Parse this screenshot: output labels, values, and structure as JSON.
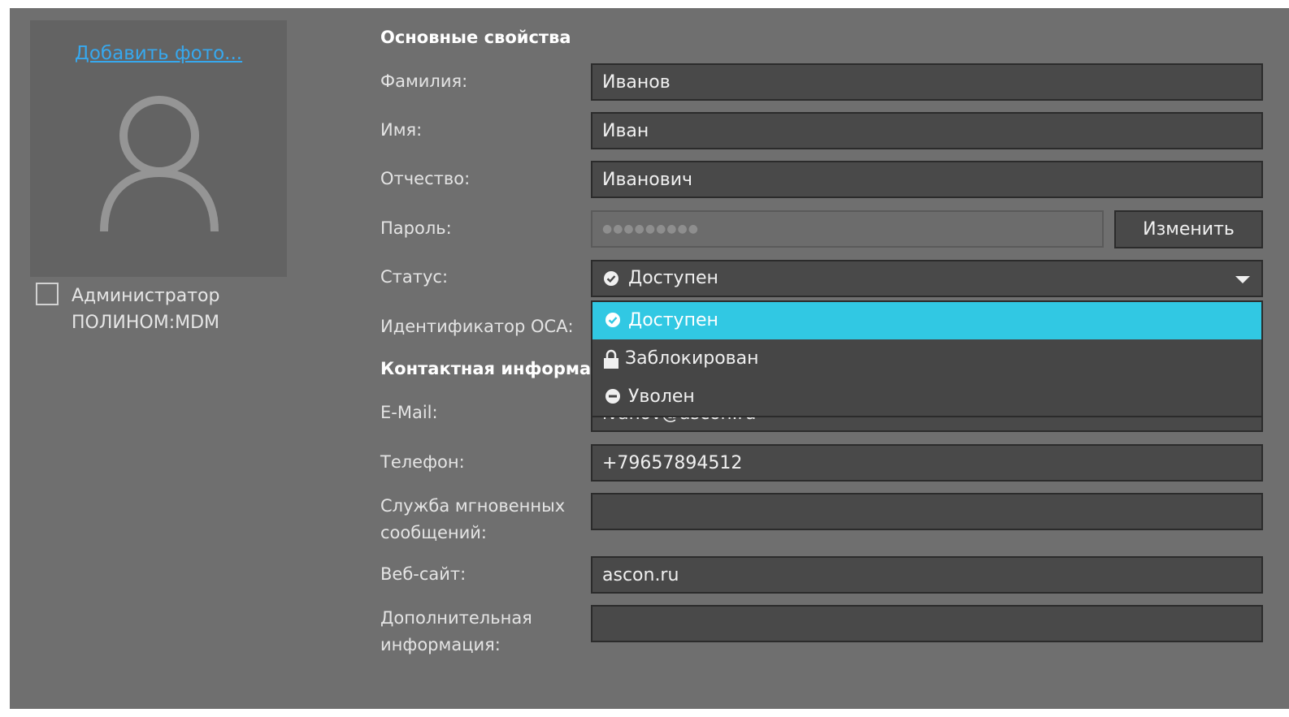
{
  "photo": {
    "add_photo_link": "Добавить фото..."
  },
  "admin": {
    "checked": false,
    "label_line1": "Администратор",
    "label_line2": "ПОЛИНОМ:MDM"
  },
  "sections": {
    "main": "Основные свойства",
    "contact": "Контактная информация"
  },
  "labels": {
    "last_name": "Фамилия:",
    "first_name": "Имя:",
    "middle_name": "Отчество:",
    "password": "Пароль:",
    "status": "Статус:",
    "osa_id": "Идентификатор ОСА:",
    "email": "E-Mail:",
    "phone": "Телефон:",
    "im_line1": "Служба мгновенных",
    "im_line2": "сообщений:",
    "website": "Веб-сайт:",
    "extra_line1": "Дополнительная",
    "extra_line2": "информация:"
  },
  "values": {
    "last_name": "Иванов",
    "first_name": "Иван",
    "middle_name": "Иванович",
    "password_mask": "●●●●●●●●●",
    "email": "ivanov@ascon.ru",
    "phone": "+79657894512",
    "im": "",
    "website": "ascon.ru",
    "extra": ""
  },
  "buttons": {
    "change_password": "Изменить"
  },
  "status": {
    "selected": "Доступен",
    "options": [
      {
        "label": "Доступен",
        "icon": "check-circle-icon"
      },
      {
        "label": "Заблокирован",
        "icon": "lock-icon"
      },
      {
        "label": "Уволен",
        "icon": "minus-circle-icon"
      }
    ]
  },
  "colors": {
    "panel": "#6f6f6f",
    "field": "#494949",
    "link": "#37a8ee",
    "selection": "#31c8e3"
  }
}
